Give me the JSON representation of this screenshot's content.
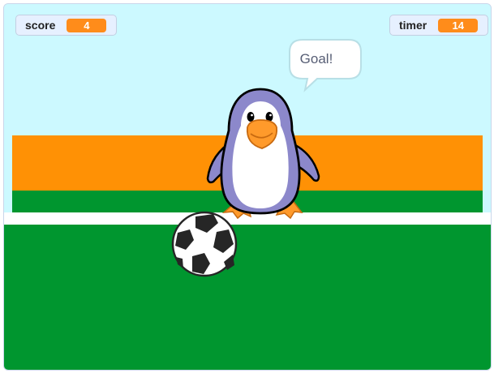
{
  "monitors": {
    "score": {
      "label": "score",
      "value": "4"
    },
    "timer": {
      "label": "timer",
      "value": "14"
    }
  },
  "sprite": {
    "name": "penguin",
    "speech": "Goal!"
  },
  "colors": {
    "sky": "#ccf9ff",
    "orange_band": "#ff9105",
    "grass": "#00962f",
    "line": "#ffffff",
    "monitor_value": "#ff8c1a"
  },
  "icons": [
    "penguin-sprite",
    "soccer-ball-sprite"
  ]
}
